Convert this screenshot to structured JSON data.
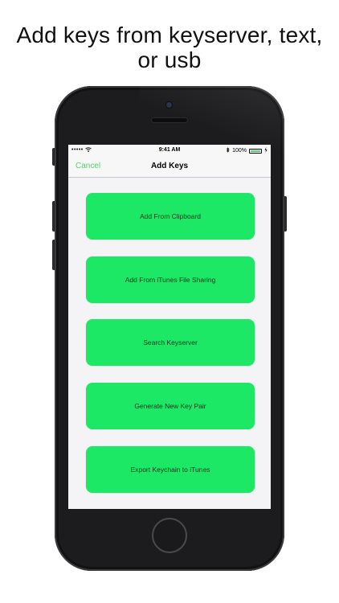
{
  "headline": {
    "line1": "Add keys from keyserver, text,",
    "line2": "or usb"
  },
  "statusbar": {
    "signal": "•••••",
    "wifi_icon": "wifi-icon",
    "time": "9:41 AM",
    "bluetooth_icon": "bluetooth-icon",
    "battery_percent": "100%",
    "battery_level": 1.0
  },
  "navbar": {
    "cancel_label": "Cancel",
    "title": "Add Keys"
  },
  "actions": [
    {
      "label": "Add From Clipboard"
    },
    {
      "label": "Add From iTunes File Sharing"
    },
    {
      "label": "Search Keyserver"
    },
    {
      "label": "Generate New Key Pair"
    },
    {
      "label": "Export Keychain to iTunes"
    }
  ],
  "colors": {
    "accent_green": "#4cd964",
    "button_green": "#1ce866",
    "phone_body": "#1c1c1e"
  }
}
